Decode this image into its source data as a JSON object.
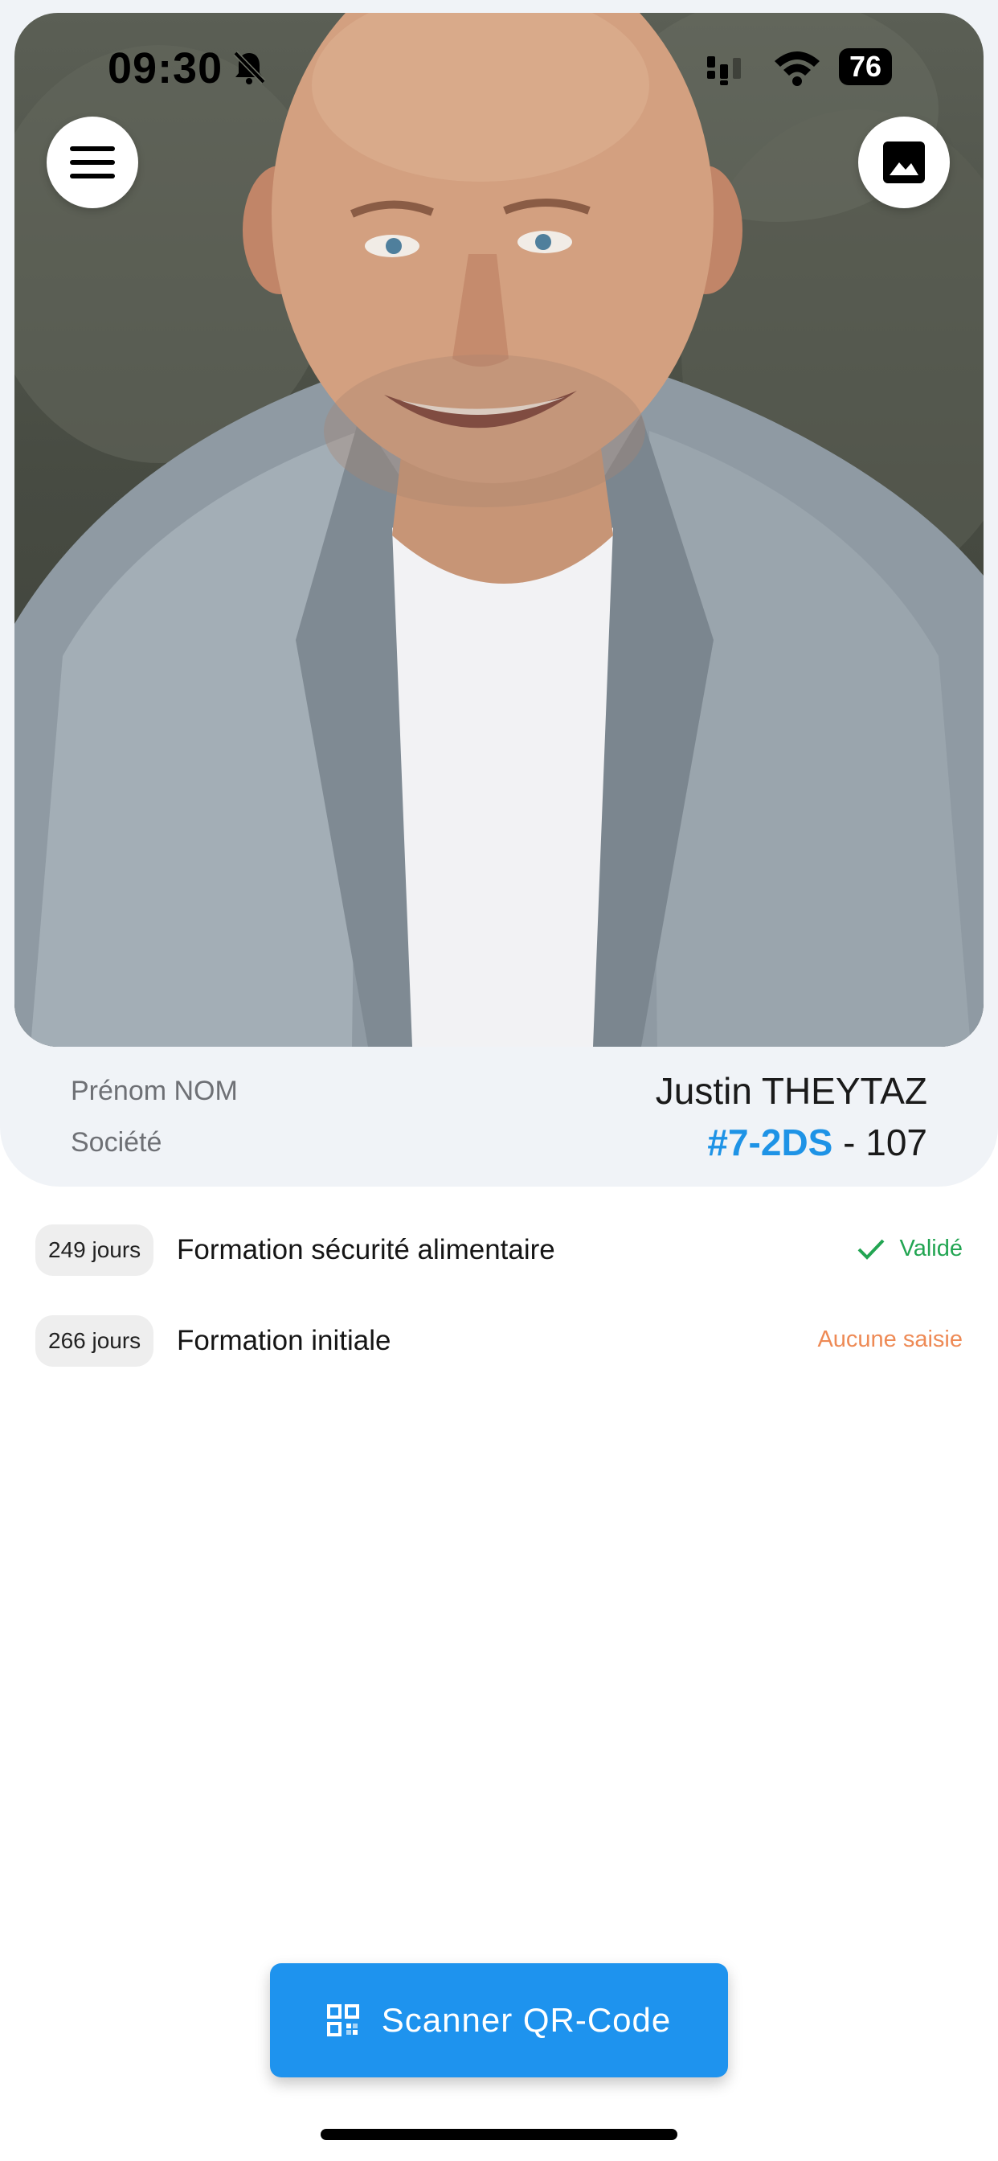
{
  "status_bar": {
    "time": "09:30",
    "battery": "76",
    "icons": [
      "bell-off-icon",
      "cellular-signal-icon",
      "wifi-icon",
      "battery-icon"
    ]
  },
  "header_buttons": {
    "menu_icon": "hamburger-menu-icon",
    "image_icon": "image-icon"
  },
  "profile": {
    "name_label": "Prénom NOM",
    "name_value": "Justin THEYTAZ",
    "company_label": "Société",
    "company_code": "#7-2DS",
    "company_sep": " - ",
    "company_number": "107"
  },
  "trainings": [
    {
      "days": "249 jours",
      "title": "Formation sécurité alimentaire",
      "status": "Validé",
      "status_icon": "check-icon",
      "status_color": "#22a552"
    },
    {
      "days": "266 jours",
      "title": "Formation initiale",
      "status": "Aucune saisie",
      "status_color": "#ee8a55"
    }
  ],
  "scan_button": {
    "label": "Scanner QR-Code",
    "icon": "qr-code-icon"
  },
  "colors": {
    "accent": "#1e93ee",
    "card_background": "#f0f3f7",
    "ok": "#22a552",
    "warning": "#ee8a55"
  }
}
